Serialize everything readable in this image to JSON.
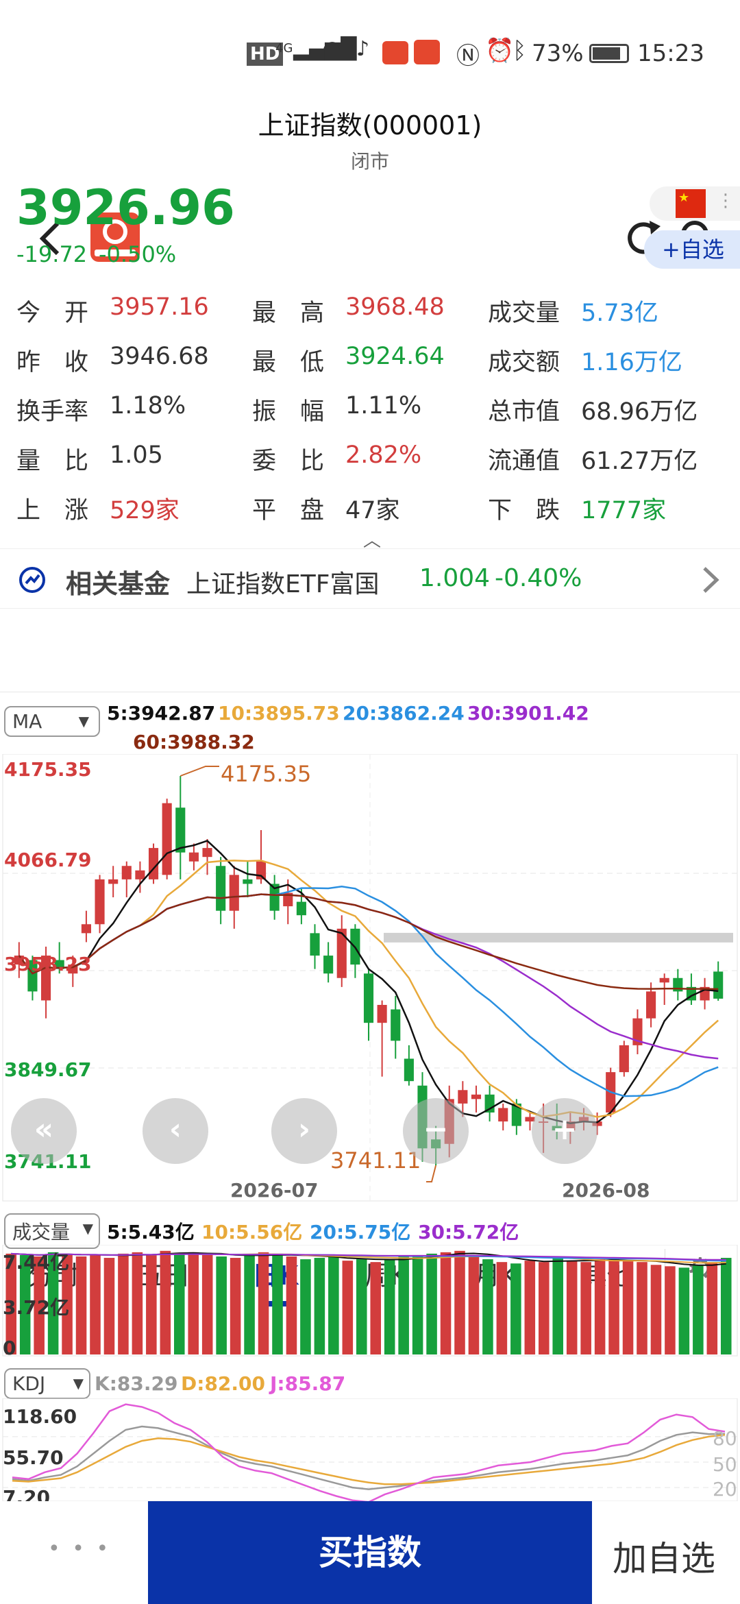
{
  "status": {
    "hd": "HD",
    "signal": "4G",
    "battery": "73%",
    "time": "15:23"
  },
  "header": {
    "title": "上证指数(000001)",
    "subtitle": "闭市"
  },
  "quote": {
    "price": "3926.96",
    "change": "-19.72",
    "change_pct": "-0.50%",
    "watch_btn": "+自选"
  },
  "stats": [
    {
      "label": "今　开",
      "value": "3957.16",
      "tone": "red"
    },
    {
      "label": "最　高",
      "value": "3968.48",
      "tone": "red"
    },
    {
      "label": "成交量",
      "value": "5.73亿",
      "tone": "blue"
    },
    {
      "label": "昨　收",
      "value": "3946.68",
      "tone": "none"
    },
    {
      "label": "最　低",
      "value": "3924.64",
      "tone": "green"
    },
    {
      "label": "成交额",
      "value": "1.16万亿",
      "tone": "blue"
    },
    {
      "label": "换手率",
      "value": "1.18%",
      "tone": "none"
    },
    {
      "label": "振　幅",
      "value": "1.11%",
      "tone": "none"
    },
    {
      "label": "总市值",
      "value": "68.96万亿",
      "tone": "none"
    },
    {
      "label": "量　比",
      "value": "1.05",
      "tone": "none"
    },
    {
      "label": "委　比",
      "value": "2.82%",
      "tone": "red"
    },
    {
      "label": "流通值",
      "value": "61.27万亿",
      "tone": "none"
    },
    {
      "label": "上　涨",
      "value": "529家",
      "tone": "red"
    },
    {
      "label": "平　盘",
      "value": "47家",
      "tone": "none"
    },
    {
      "label": "下　跌",
      "value": "1777家",
      "tone": "green"
    }
  ],
  "fund": {
    "label": "相关基金",
    "name": "上证指数ETF富国",
    "price": "1.004",
    "pct": "-0.40%"
  },
  "tabs": [
    "分时",
    "五日",
    "日K",
    "周K",
    "月K",
    "其他"
  ],
  "active_tab": "日K",
  "ma": {
    "selector": "MA",
    "ma5": "5:3942.87",
    "ma10": "10:3895.73",
    "ma20": "20:3862.24",
    "ma30": "30:3901.42",
    "ma60": "60:3988.32"
  },
  "kline": {
    "y_labels": [
      "4175.35",
      "4066.79",
      "3958.23",
      "3849.67",
      "3741.11"
    ],
    "high_mark": "4175.35",
    "low_mark": "3741.11",
    "x_labels": [
      "2026-07",
      "2026-08"
    ]
  },
  "vol": {
    "selector": "成交量",
    "v5": "5:5.43亿",
    "v10": "10:5.56亿",
    "v20": "20:5.75亿",
    "v30": "30:5.72亿",
    "y_labels": [
      "7.44亿",
      "3.72亿",
      "0"
    ]
  },
  "kdj": {
    "selector": "KDJ",
    "k": "K:83.29",
    "d": "D:82.00",
    "j": "J:85.87",
    "y_labels": [
      "118.60",
      "55.70",
      "7.20"
    ],
    "right_labels": [
      "80",
      "50",
      "20"
    ]
  },
  "bottom": {
    "more": "• • •",
    "buy": "买指数",
    "add": "加自选"
  },
  "colors": {
    "up": "#d23d3d",
    "down": "#17a03c",
    "ma5": "#111111",
    "ma10": "#e8a93a",
    "ma20": "#2a8fe0",
    "ma30": "#9a2dcc",
    "ma60": "#8a2a10",
    "primary": "#0a33a8"
  },
  "chart_data": [
    {
      "type": "candlestick",
      "title": "",
      "y_range": [
        3741.11,
        4175.35
      ],
      "series": [
        {
          "o": 3965,
          "h": 3990,
          "l": 3950,
          "c": 3975
        },
        {
          "o": 3970,
          "h": 3975,
          "l": 3925,
          "c": 3935
        },
        {
          "o": 3925,
          "h": 3985,
          "l": 3905,
          "c": 3975
        },
        {
          "o": 3970,
          "h": 3990,
          "l": 3955,
          "c": 3960
        },
        {
          "o": 3955,
          "h": 3975,
          "l": 3940,
          "c": 3965
        },
        {
          "o": 4000,
          "h": 4025,
          "l": 3990,
          "c": 4010
        },
        {
          "o": 4010,
          "h": 4065,
          "l": 4000,
          "c": 4060
        },
        {
          "o": 4055,
          "h": 4075,
          "l": 4040,
          "c": 4060
        },
        {
          "o": 4060,
          "h": 4080,
          "l": 4040,
          "c": 4075
        },
        {
          "o": 4060,
          "h": 4080,
          "l": 4045,
          "c": 4070
        },
        {
          "o": 4060,
          "h": 4100,
          "l": 4055,
          "c": 4095
        },
        {
          "o": 4065,
          "h": 4150,
          "l": 4060,
          "c": 4145
        },
        {
          "o": 4140,
          "h": 4175.35,
          "l": 4060,
          "c": 4090
        },
        {
          "o": 4080,
          "h": 4100,
          "l": 4070,
          "c": 4090
        },
        {
          "o": 4085,
          "h": 4105,
          "l": 4065,
          "c": 4095
        },
        {
          "o": 4075,
          "h": 4085,
          "l": 4010,
          "c": 4025
        },
        {
          "o": 4025,
          "h": 4075,
          "l": 4005,
          "c": 4065
        },
        {
          "o": 4060,
          "h": 4080,
          "l": 4040,
          "c": 4055
        },
        {
          "o": 4060,
          "h": 4115,
          "l": 4055,
          "c": 4080
        },
        {
          "o": 4055,
          "h": 4065,
          "l": 4015,
          "c": 4025
        },
        {
          "o": 4030,
          "h": 4060,
          "l": 4010,
          "c": 4045
        },
        {
          "o": 4035,
          "h": 4050,
          "l": 4010,
          "c": 4020
        },
        {
          "o": 4000,
          "h": 4010,
          "l": 3960,
          "c": 3975
        },
        {
          "o": 3975,
          "h": 3990,
          "l": 3945,
          "c": 3955
        },
        {
          "o": 3950,
          "h": 4020,
          "l": 3940,
          "c": 4005
        },
        {
          "o": 4005,
          "h": 4010,
          "l": 3950,
          "c": 3965
        },
        {
          "o": 3955,
          "h": 3960,
          "l": 3880,
          "c": 3900
        },
        {
          "o": 3900,
          "h": 3925,
          "l": 3840,
          "c": 3920
        },
        {
          "o": 3915,
          "h": 3930,
          "l": 3860,
          "c": 3880
        },
        {
          "o": 3860,
          "h": 3875,
          "l": 3830,
          "c": 3835
        },
        {
          "o": 3830,
          "h": 3845,
          "l": 3745,
          "c": 3760
        },
        {
          "o": 3770,
          "h": 3785,
          "l": 3741.11,
          "c": 3760
        },
        {
          "o": 3765,
          "h": 3830,
          "l": 3750,
          "c": 3815
        },
        {
          "o": 3810,
          "h": 3835,
          "l": 3795,
          "c": 3825
        },
        {
          "o": 3815,
          "h": 3830,
          "l": 3800,
          "c": 3820
        },
        {
          "o": 3820,
          "h": 3830,
          "l": 3790,
          "c": 3800
        },
        {
          "o": 3790,
          "h": 3810,
          "l": 3780,
          "c": 3805
        },
        {
          "o": 3810,
          "h": 3815,
          "l": 3775,
          "c": 3785
        },
        {
          "o": 3790,
          "h": 3800,
          "l": 3780,
          "c": 3795
        },
        {
          "o": 3790,
          "h": 3810,
          "l": 3755,
          "c": 3790
        },
        {
          "o": 3785,
          "h": 3810,
          "l": 3770,
          "c": 3780
        },
        {
          "o": 3780,
          "h": 3800,
          "l": 3765,
          "c": 3790
        },
        {
          "o": 3790,
          "h": 3805,
          "l": 3780,
          "c": 3795
        },
        {
          "o": 3785,
          "h": 3800,
          "l": 3775,
          "c": 3790
        },
        {
          "o": 3800,
          "h": 3850,
          "l": 3795,
          "c": 3845
        },
        {
          "o": 3845,
          "h": 3880,
          "l": 3840,
          "c": 3875
        },
        {
          "o": 3875,
          "h": 3915,
          "l": 3865,
          "c": 3905
        },
        {
          "o": 3905,
          "h": 3945,
          "l": 3895,
          "c": 3935
        },
        {
          "o": 3945,
          "h": 3955,
          "l": 3920,
          "c": 3950
        },
        {
          "o": 3950,
          "h": 3960,
          "l": 3925,
          "c": 3935
        },
        {
          "o": 3940,
          "h": 3955,
          "l": 3920,
          "c": 3925
        },
        {
          "o": 3925,
          "h": 3950,
          "l": 3915,
          "c": 3940
        },
        {
          "o": 3957.16,
          "h": 3968.48,
          "l": 3924.64,
          "c": 3926.96
        }
      ]
    },
    {
      "type": "bar",
      "title": "成交量",
      "unit": "亿",
      "values": [
        7.2,
        7.1,
        7.0,
        7.3,
        7.2,
        7.0,
        7.1,
        6.9,
        7.2,
        7.3,
        7.1,
        7.4,
        7.2,
        7.3,
        7.1,
        7.0,
        6.9,
        7.1,
        7.3,
        7.2,
        7.0,
        6.8,
        6.9,
        7.0,
        6.7,
        6.8,
        6.6,
        6.8,
        7.0,
        7.1,
        7.2,
        7.3,
        7.4,
        7.1,
        6.8,
        6.6,
        6.5,
        6.7,
        6.6,
        6.9,
        6.7,
        6.6,
        6.8,
        6.8,
        6.7,
        6.6,
        6.4,
        6.3,
        6.2,
        6.4,
        6.6,
        6.9
      ]
    },
    {
      "type": "line",
      "title": "KDJ",
      "y_range": [
        7.2,
        118.6
      ],
      "series": [
        {
          "name": "K",
          "values": [
            30,
            28,
            32,
            35,
            45,
            60,
            75,
            88,
            92,
            90,
            85,
            80,
            70,
            60,
            52,
            48,
            45,
            40,
            35,
            30,
            25,
            20,
            18,
            20,
            22,
            25,
            28,
            30,
            32,
            35,
            38,
            40,
            42,
            45,
            48,
            50,
            52,
            55,
            58,
            65,
            75,
            82,
            85,
            83,
            83.29
          ]
        },
        {
          "name": "D",
          "values": [
            28,
            27,
            29,
            31,
            38,
            48,
            58,
            68,
            75,
            78,
            77,
            74,
            68,
            62,
            56,
            52,
            49,
            45,
            41,
            37,
            33,
            29,
            26,
            24,
            24,
            25,
            26,
            28,
            30,
            32,
            34,
            36,
            38,
            40,
            42,
            44,
            46,
            48,
            51,
            55,
            62,
            70,
            76,
            80,
            82.0
          ]
        },
        {
          "name": "J",
          "values": [
            32,
            30,
            38,
            43,
            60,
            84,
            110,
            118,
            115,
            108,
            96,
            88,
            74,
            56,
            45,
            40,
            37,
            30,
            23,
            16,
            10,
            5,
            3,
            12,
            18,
            25,
            32,
            34,
            36,
            41,
            46,
            48,
            50,
            55,
            60,
            62,
            64,
            69,
            72,
            85,
            100,
            106,
            103,
            89,
            85.87
          ]
        }
      ]
    }
  ]
}
